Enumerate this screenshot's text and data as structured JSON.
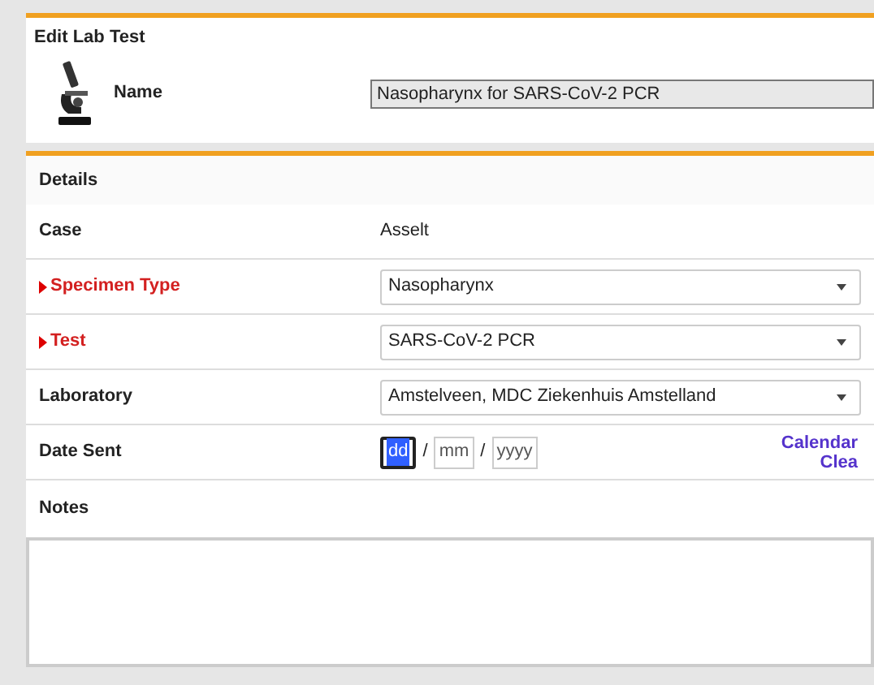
{
  "header": {
    "title": "Edit Lab Test",
    "name_label": "Name",
    "name_value": "Nasopharynx for SARS-CoV-2 PCR"
  },
  "details": {
    "title": "Details",
    "rows": [
      {
        "kind": "text",
        "label": "Case",
        "required": false,
        "value": "Asselt"
      },
      {
        "kind": "select",
        "label": "Specimen Type",
        "required": true,
        "value": "Nasopharynx"
      },
      {
        "kind": "select",
        "label": "Test",
        "required": true,
        "value": "SARS-CoV-2 PCR"
      },
      {
        "kind": "select",
        "label": "Laboratory",
        "required": false,
        "value": "Amstelveen, MDC Ziekenhuis Amstelland"
      },
      {
        "kind": "date",
        "label": "Date Sent",
        "required": false,
        "parts": [
          {
            "placeholder": "dd",
            "focused": true
          },
          {
            "placeholder": "mm",
            "focused": false
          },
          {
            "placeholder": "yyyy",
            "focused": false
          }
        ],
        "separator": "/",
        "links": [
          "Calendar",
          "Clea"
        ]
      }
    ],
    "notes_label": "Notes"
  }
}
